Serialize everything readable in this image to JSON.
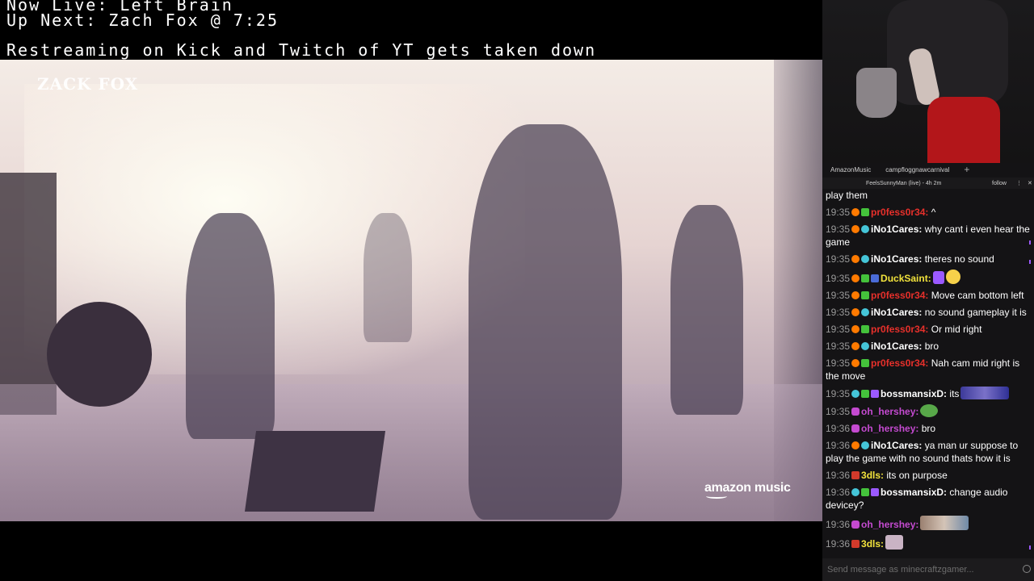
{
  "overlay": {
    "line1": "Now Live: Left Brain",
    "line2": "Up Next: Zach Fox @ 7:25",
    "line3": "Restreaming on Kick and Twitch of YT gets taken down"
  },
  "video": {
    "watermark": "ZACK FOX",
    "brand": "amazon music"
  },
  "chat": {
    "tabs": [
      "AmazonMusic",
      "campfloggnawcarnival",
      "+"
    ],
    "subhead": {
      "title": "FeelsSunnyMan (live) - 4h 2m",
      "follow": "follow",
      "more": "⋮",
      "close": "✕"
    },
    "partial": "play them",
    "messages": [
      {
        "time": "19:35",
        "user": "pr0fess0r34",
        "color": "#e8302b",
        "badges": [
          "sun",
          "leaf"
        ],
        "text": "^"
      },
      {
        "time": "19:35",
        "user": "iNo1Cares",
        "color": "#ffffff",
        "badges": [
          "sun",
          "snow"
        ],
        "text": "why cant i even hear the game"
      },
      {
        "time": "19:35",
        "user": "iNo1Cares",
        "color": "#ffffff",
        "badges": [
          "sun",
          "snow"
        ],
        "text": "theres no sound"
      },
      {
        "time": "19:35",
        "user": "DuckSaint",
        "color": "#f2e33c",
        "badges": [
          "sun",
          "leaf",
          "blue"
        ],
        "text": ""
      },
      {
        "time": "19:35",
        "user": "pr0fess0r34",
        "color": "#e8302b",
        "badges": [
          "sun",
          "leaf"
        ],
        "text": "Move cam bottom left"
      },
      {
        "time": "19:35",
        "user": "iNo1Cares",
        "color": "#ffffff",
        "badges": [
          "sun",
          "snow"
        ],
        "text": "no sound gameplay it is"
      },
      {
        "time": "19:35",
        "user": "pr0fess0r34",
        "color": "#e8302b",
        "badges": [
          "sun",
          "leaf"
        ],
        "text": "Or mid right"
      },
      {
        "time": "19:35",
        "user": "iNo1Cares",
        "color": "#ffffff",
        "badges": [
          "sun",
          "snow"
        ],
        "text": "bro"
      },
      {
        "time": "19:35",
        "user": "pr0fess0r34",
        "color": "#e8302b",
        "badges": [
          "sun",
          "leaf"
        ],
        "text": "Nah cam mid right is the move"
      },
      {
        "time": "19:35",
        "user": "bossmansixD",
        "color": "#ffffff",
        "badges": [
          "snow",
          "leaf",
          "sub"
        ],
        "text": "its"
      },
      {
        "time": "19:35",
        "user": "oh_hershey",
        "color": "#c44ad0",
        "badges": [
          "mod"
        ],
        "text": ""
      },
      {
        "time": "19:36",
        "user": "oh_hershey",
        "color": "#c44ad0",
        "badges": [
          "mod"
        ],
        "text": "bro"
      },
      {
        "time": "19:36",
        "user": "iNo1Cares",
        "color": "#ffffff",
        "badges": [
          "sun",
          "snow"
        ],
        "text": "ya man ur suppose to play the game with no sound thats how it is"
      },
      {
        "time": "19:36",
        "user": "3dls",
        "color": "#f2e33c",
        "badges": [
          "red"
        ],
        "text": "its on purpose"
      },
      {
        "time": "19:36",
        "user": "bossmansixD",
        "color": "#ffffff",
        "badges": [
          "snow",
          "leaf",
          "sub"
        ],
        "text": "change audio devicey?"
      },
      {
        "time": "19:36",
        "user": "oh_hershey",
        "color": "#c44ad0",
        "badges": [
          "mod"
        ],
        "text": ""
      },
      {
        "time": "19:36",
        "user": "3dls",
        "color": "#f2e33c",
        "badges": [
          "red"
        ],
        "text": ""
      }
    ],
    "input_placeholder": "Send message as minecraftzgamer..."
  }
}
